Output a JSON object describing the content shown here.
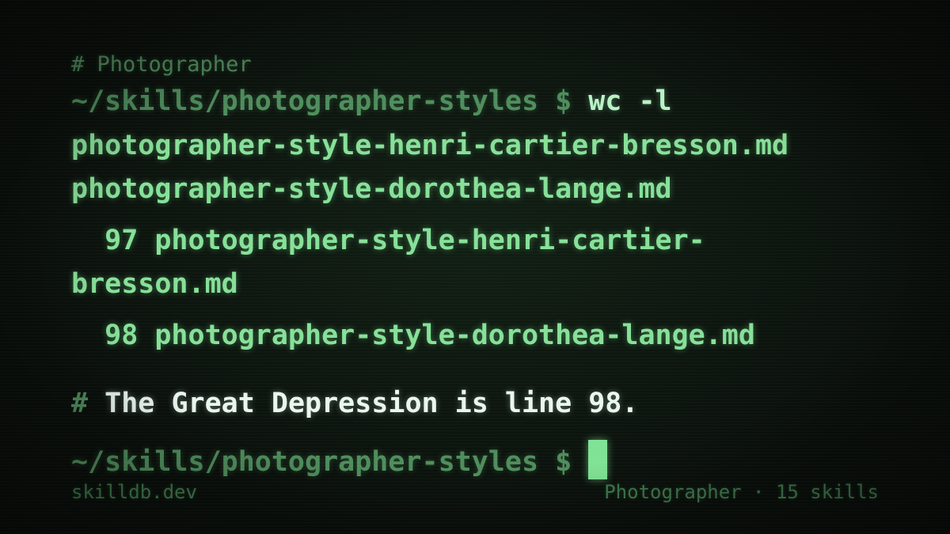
{
  "header_comment": "# Photographer",
  "prompt_line_1": {
    "prompt": "~/skills/photographer-styles $ ",
    "command": "wc -l"
  },
  "command_args": [
    "photographer-style-henri-cartier-bresson.md",
    "photographer-style-dorothea-lange.md"
  ],
  "output": [
    "  97 photographer-style-henri-cartier-",
    "bresson.md",
    "  98 photographer-style-dorothea-lange.md"
  ],
  "note": {
    "hash": "# ",
    "text": "The Great Depression is line 98."
  },
  "prompt_line_2": {
    "prompt": "~/skills/photographer-styles $ "
  },
  "footer": {
    "site": "skilldb.dev",
    "category": "Photographer · 15 skills"
  },
  "colors": {
    "background": "#0a0f0b",
    "prompt": "#4e8d5c",
    "output": "#86e098",
    "command": "#b9f2c6",
    "note": "#eaf7ee",
    "cursor": "#7fe295"
  }
}
